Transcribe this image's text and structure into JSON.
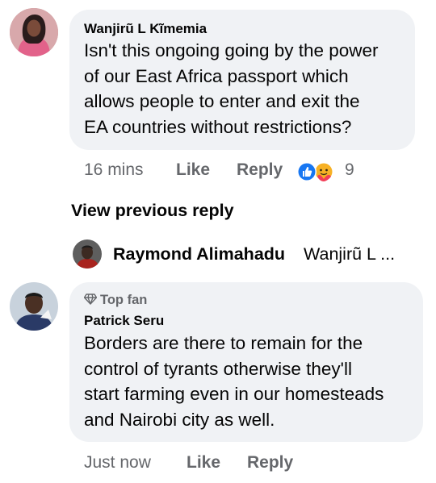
{
  "comment1": {
    "author": "Wanjirũ L Kĩmemia",
    "lines": [
      "Isn't this ongoing going by the power",
      "of our East Africa passport which",
      "allows people to enter and exit the",
      "EA countries without restrictions?"
    ],
    "time": "16 mins",
    "like": "Like",
    "reply": "Reply",
    "reaction_count": "9"
  },
  "view_previous_reply": "View previous reply",
  "reply_preview": {
    "author": "Raymond Alimahadu",
    "snippet": "Wanjirũ L ..."
  },
  "comment2": {
    "badge": "Top fan",
    "author": "Patrick Seru",
    "lines": [
      "Borders are there to remain for the",
      "control of tyrants otherwise they'll",
      "start farming even in our homesteads",
      "and Nairobi city as well."
    ],
    "time": "Just now",
    "like": "Like",
    "reply": "Reply"
  },
  "colors": {
    "bubble": "#f0f2f5",
    "meta_text": "#65676b",
    "like_blue": "#1877f2",
    "care_yellow": "#f7b125"
  },
  "icons": [
    "avatar-wanjiru",
    "avatar-raymond",
    "avatar-patrick",
    "like-reaction-icon",
    "care-reaction-icon",
    "top-fan-diamond-icon"
  ]
}
